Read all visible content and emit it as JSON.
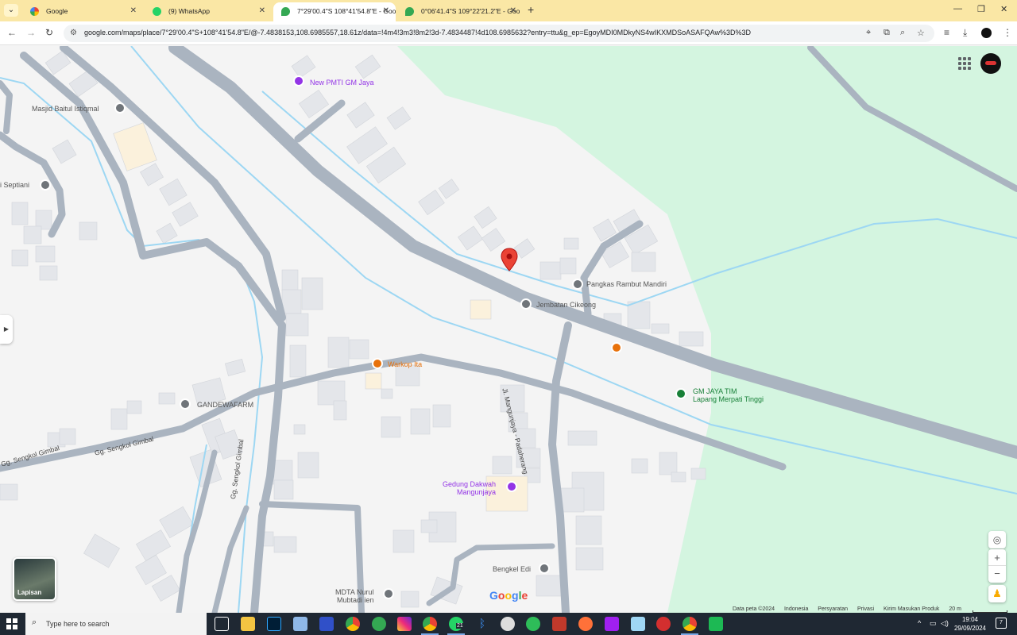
{
  "browser": {
    "tabs": [
      {
        "title": "Google",
        "active": false
      },
      {
        "title": "(9) WhatsApp",
        "active": false
      },
      {
        "title": "7°29'00.4\"S 108°41'54.8\"E - Goo",
        "active": true
      },
      {
        "title": "0°06'41.4\"S 109°22'21.2\"E - Goo",
        "active": false
      }
    ],
    "url": "google.com/maps/place/7°29'00.4\"S+108°41'54.8\"E/@-7.4838153,108.6985557,18.61z/data=!4m4!3m3!8m2!3d-7.4834487!4d108.6985632?entry=ttu&g_ep=EgoyMDI0MDkyNS4wIKXMDSoASAFQAw%3D%3D"
  },
  "map": {
    "poi": [
      {
        "name": "New PMTI GM Jaya",
        "color": "purple"
      },
      {
        "name": "Masjid Baitul Istiqmal",
        "color": "gray"
      },
      {
        "name": "i Septiani",
        "color": "gray"
      },
      {
        "name": "Pangkas Rambut Mandiri",
        "color": "gray"
      },
      {
        "name": "Jembatan Cikeong",
        "color": "gray"
      },
      {
        "name": "Warkop Ita",
        "color": "orange"
      },
      {
        "name": "GANDEWAFARM",
        "color": "gray"
      },
      {
        "name": "GM JAYA TIM",
        "sub": "Lapang Merpati Tinggi",
        "color": "green"
      },
      {
        "name": "Gedung Dakwah",
        "sub": "Mangunjaya",
        "color": "purple"
      },
      {
        "name": "Bengkel Edi",
        "color": "gray"
      },
      {
        "name": "MDTA Nurul",
        "sub": "Mubtadi ien",
        "color": "gray"
      }
    ],
    "roads": {
      "jl_mangunjaya": "Jl. Mangunjaya - Padaherang",
      "sengkol_gimbal_1": "Gg. Sengkol Gimbal",
      "sengkol_gimbal_2": "Gg. Sengkol Gimbal",
      "sengkol_gimbal_3": "Gg. Sengkol Gimbal"
    },
    "layers_label": "Lapisan",
    "google_logo": "Google",
    "attribution": [
      "Data peta ©2024",
      "Indonesia",
      "Persyaratan",
      "Privasi",
      "Kirim Masukan Produk",
      "20 m"
    ]
  },
  "taskbar": {
    "search_placeholder": "Type here to search",
    "time": "19:04",
    "date": "29/09/2024",
    "whatsapp_badge": "21",
    "notifications": "7"
  },
  "colors": {
    "tabbar_bg": "#fae7a5",
    "water": "#9dd7f3",
    "road": "#aab4c0",
    "park": "#d4f5e0",
    "pin": "#ea4335"
  }
}
